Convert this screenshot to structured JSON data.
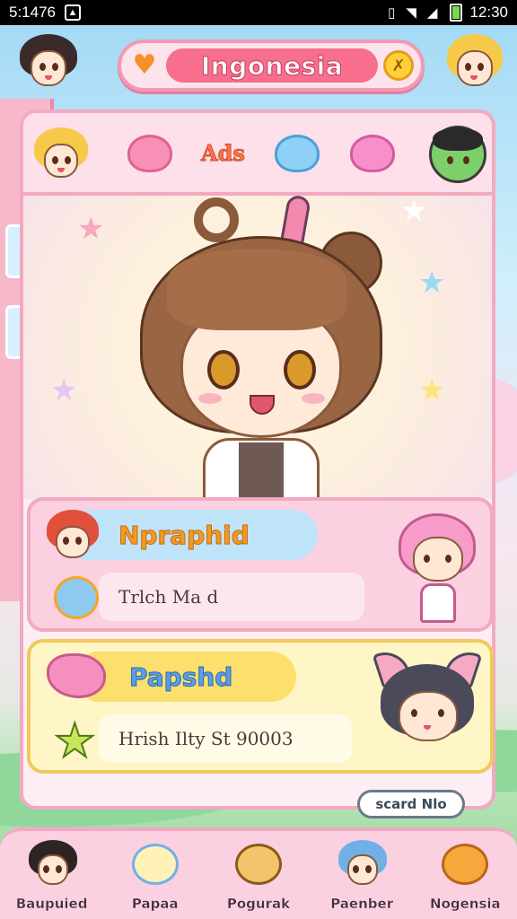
{
  "status_bar": {
    "time": "5:1476",
    "clock": "12:30",
    "icons": [
      "notification-icon",
      "vibrate-icon",
      "wifi-icon",
      "signal-icon",
      "battery-icon"
    ]
  },
  "header": {
    "title": "Ingonesia",
    "left_icon": "heart-icon",
    "right_icon": "coin-icon",
    "right_icon_glyph": "✗"
  },
  "tabs": {
    "ads_label": "Ads",
    "items": [
      "character-avatar",
      "pink-blob",
      "ads",
      "blue-blob",
      "pink-blob-2",
      "green-character"
    ]
  },
  "cards": [
    {
      "name": "Npraphid",
      "detail": "Trlch Ma d"
    },
    {
      "name": "Papshd",
      "detail": "Hrish Ilty St 90003",
      "button": "scard Nlo"
    }
  ],
  "bottom_nav": [
    {
      "label": "Baupuied"
    },
    {
      "label": "Papaa"
    },
    {
      "label": "Pogurak"
    },
    {
      "label": "Paenber"
    },
    {
      "label": "Nogensia"
    }
  ],
  "colors": {
    "accent_pink": "#f76f8d",
    "panel_pink": "#fbd0e0",
    "panel_yellow": "#fff6c7",
    "border_pink": "#f3a9c1"
  }
}
